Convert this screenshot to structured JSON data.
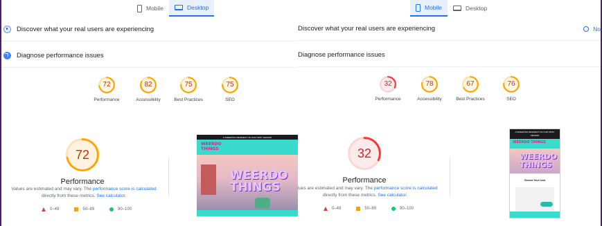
{
  "left": {
    "tabs": [
      {
        "label": "Mobile",
        "icon": "phone-icon",
        "active": false
      },
      {
        "label": "Desktop",
        "icon": "laptop-icon",
        "active": true
      }
    ],
    "discover_label": "Discover what your real users are experiencing",
    "diagnose_label": "Diagnose performance issues",
    "scores": [
      {
        "label": "Performance",
        "value": "72",
        "color": "#ffa400"
      },
      {
        "label": "Accessibility",
        "value": "82",
        "color": "#ffa400"
      },
      {
        "label": "Best Practices",
        "value": "75",
        "color": "#ffa400"
      },
      {
        "label": "SEO",
        "value": "75",
        "color": "#ffa400"
      }
    ],
    "main_score": {
      "value": "72",
      "label": "Performance",
      "color": "#ffa400"
    },
    "screenshot": {
      "banner": "A SWEEPING RESIDENT ON OUR FIRST SEASON",
      "logo_line1": "WEERDO",
      "logo_line2": "THINGS",
      "hero_word": "WEERDO THINGS"
    }
  },
  "right": {
    "tabs": [
      {
        "label": "Mobile",
        "icon": "phone-icon",
        "active": true
      },
      {
        "label": "Desktop",
        "icon": "laptop-icon",
        "active": false
      }
    ],
    "discover_label": "Discover what your real users are experiencing",
    "no_data_label": "No",
    "diagnose_label": "Diagnose performance issues",
    "scores": [
      {
        "label": "Performance",
        "value": "32",
        "color": "#ff3333"
      },
      {
        "label": "Accessibility",
        "value": "78",
        "color": "#ffa400"
      },
      {
        "label": "Best Practices",
        "value": "67",
        "color": "#ffa400"
      },
      {
        "label": "SEO",
        "value": "76",
        "color": "#ffa400"
      }
    ],
    "main_score": {
      "value": "32",
      "label": "Performance",
      "color": "#ff3333"
    },
    "screenshot": {
      "banner": "A SWEEPING RESIDENT ON OUR FIRST SEASON",
      "logo": "WEERDO THINGS",
      "hero_word_line1": "WEERDO",
      "hero_word_line2": "THINGS",
      "heading": "Choose Your Look"
    }
  },
  "note": {
    "prefix": "Values are estimated and may vary. The ",
    "link1": "performance score is calculated",
    "middle": " directly from these metrics. ",
    "link2": "See calculator."
  },
  "legend": {
    "poor": "0–49",
    "average": "50–89",
    "good": "90–100",
    "poor_color": "#e53935",
    "average_color": "#ffa000",
    "good_color": "#0cce6b"
  }
}
